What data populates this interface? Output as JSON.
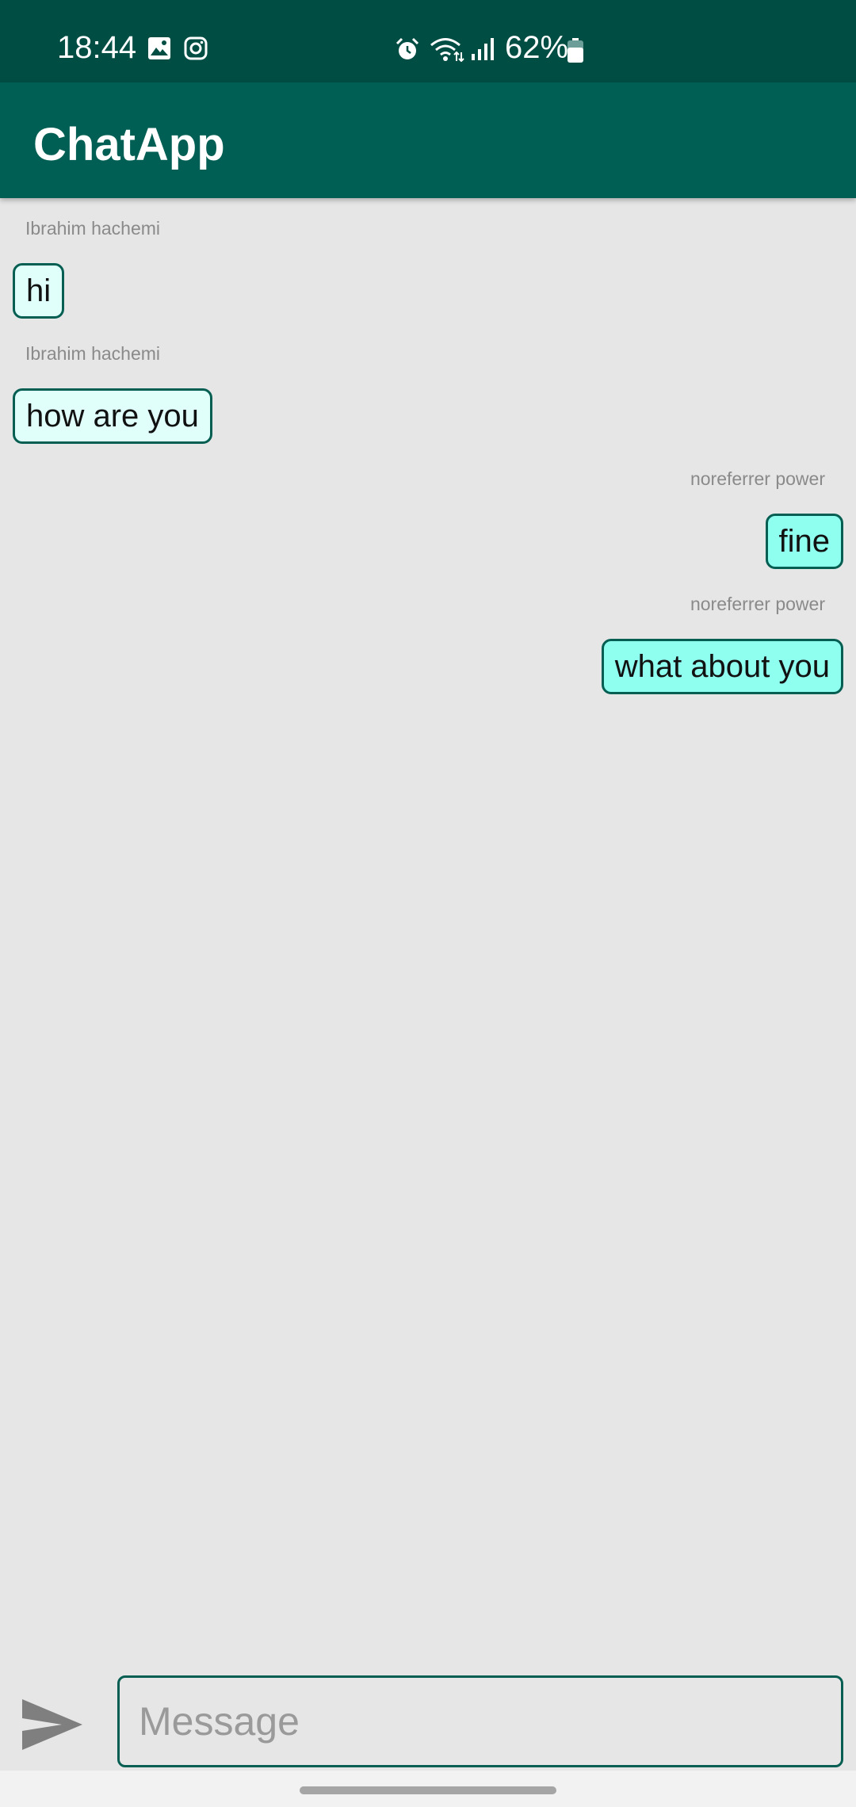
{
  "status_bar": {
    "time": "18:44",
    "battery_percent": "62%",
    "left_icons": [
      "image-icon",
      "instagram-icon"
    ],
    "right_icons": [
      "alarm-icon",
      "wifi-icon",
      "signal-icon",
      "battery-icon"
    ]
  },
  "app_bar": {
    "title": "ChatApp"
  },
  "messages": [
    {
      "sender": "Ibrahim hachemi",
      "text": "hi",
      "side": "left"
    },
    {
      "sender": "Ibrahim hachemi",
      "text": "how are you",
      "side": "left"
    },
    {
      "sender": "noreferrer power",
      "text": "fine",
      "side": "right"
    },
    {
      "sender": "noreferrer power",
      "text": "what about you",
      "side": "right"
    }
  ],
  "composer": {
    "placeholder": "Message",
    "value": "",
    "send_icon": "send-icon"
  },
  "colors": {
    "status_bar": "#004d44",
    "app_bar": "#005f54",
    "background": "#e6e6e6",
    "incoming_bubble": "#e0fffb",
    "outgoing_bubble": "#8ffff0",
    "bubble_border": "#055e52"
  }
}
